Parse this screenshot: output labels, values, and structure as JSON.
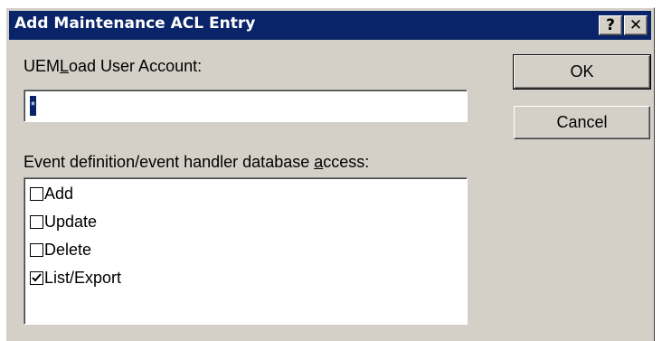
{
  "window": {
    "title": "Add Maintenance ACL Entry",
    "help_label": "?",
    "close_label": "✕"
  },
  "form": {
    "user_label_pre": "UEM",
    "user_label_mnemonic": "L",
    "user_label_post": "oad User Account:",
    "user_value": "*",
    "access_label_pre": "Event definition/event handler database ",
    "access_label_mnemonic": "a",
    "access_label_post": "ccess:"
  },
  "buttons": {
    "ok": "OK",
    "cancel": "Cancel"
  },
  "access_items": [
    {
      "label": "Add",
      "checked": false
    },
    {
      "label": "Update",
      "checked": false
    },
    {
      "label": "Delete",
      "checked": false
    },
    {
      "label": "List/Export",
      "checked": true
    }
  ],
  "colors": {
    "title_bar": "#0a246a",
    "dialog_face": "#d4d0c8"
  }
}
